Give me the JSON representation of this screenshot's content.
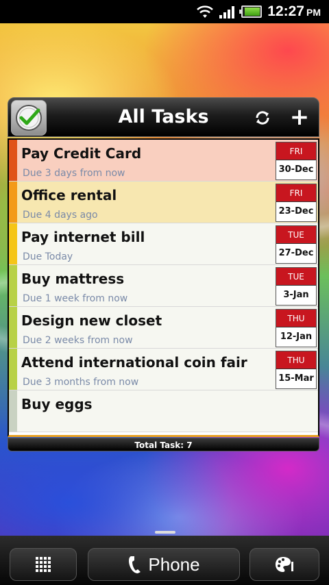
{
  "status_bar": {
    "time": "12:27",
    "ampm": "PM"
  },
  "widget": {
    "title": "All Tasks",
    "footer_label": "Total Task:",
    "total_count": "7",
    "colors": {
      "header": "#000000",
      "badge_day": "#c8161f",
      "footer_accent": "#e8a020"
    }
  },
  "tasks": [
    {
      "title": "Pay Credit Card",
      "due": "Due 3 days from now",
      "day": "FRI",
      "date": "30-Dec",
      "stripe": "#e0541a",
      "bg": "#f9cfbf"
    },
    {
      "title": "Office rental",
      "due": "Due 4 days ago",
      "day": "FRI",
      "date": "23-Dec",
      "stripe": "#f39a19",
      "bg": "#f7e7b0"
    },
    {
      "title": "Pay internet bill",
      "due": "Due Today",
      "day": "TUE",
      "date": "27-Dec",
      "stripe": "#f5c518",
      "bg": "#f6f7f1"
    },
    {
      "title": "Buy mattress",
      "due": "Due 1 week from now",
      "day": "TUE",
      "date": "3-Jan",
      "stripe": "#b8d146",
      "bg": "#f6f7f1"
    },
    {
      "title": "Design new closet",
      "due": "Due 2 weeks from now",
      "day": "THU",
      "date": "12-Jan",
      "stripe": "#b8d146",
      "bg": "#f6f7f1"
    },
    {
      "title": "Attend international coin fair",
      "due": "Due 3 months from now",
      "day": "THU",
      "date": "15-Mar",
      "stripe": "#b8d146",
      "bg": "#f6f7f1"
    },
    {
      "title": "Buy eggs",
      "due": "",
      "day": "",
      "date": "",
      "stripe": "#c9d2c2",
      "bg": "#f6f7f1"
    }
  ],
  "dock": {
    "phone_label": "Phone"
  },
  "icons": {
    "logo": "clock-check-icon",
    "refresh": "refresh-icon",
    "add": "plus-icon",
    "all_apps": "grid-icon",
    "phone": "phone-handset-icon",
    "personalize": "paint-palette-icon"
  }
}
